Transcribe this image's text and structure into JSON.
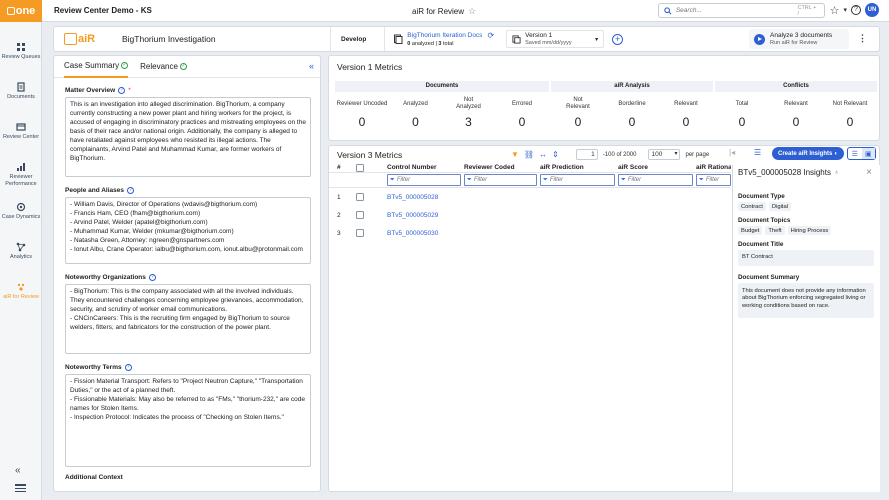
{
  "topbar": {
    "logo_text": "one",
    "app_title": "Review Center Demo - KS",
    "center_title": "aiR for Review",
    "search_placeholder": "Search...",
    "search_shortcut": "CTRL + /",
    "user_initials": "UN"
  },
  "sidebar": {
    "items": [
      {
        "label": "Review Queues",
        "icon": "review-queues-icon"
      },
      {
        "label": "Documents",
        "icon": "documents-icon"
      },
      {
        "label": "Review Center",
        "icon": "review-center-icon"
      },
      {
        "label": "Reviewer Performance",
        "icon": "reviewer-performance-icon"
      },
      {
        "label": "Case Dynamics",
        "icon": "case-dynamics-icon"
      },
      {
        "label": "Analytics",
        "icon": "analytics-icon"
      },
      {
        "label": "aiR for Review",
        "icon": "air-icon"
      }
    ]
  },
  "header": {
    "air_logo_text": "aiR",
    "investigation": "BigThorium Investigation",
    "develop": "Develop",
    "docs_name": "BigThorium Iteration Docs",
    "docs_analyzed": "0",
    "docs_analyzed_label": "analyzed",
    "docs_total": "3",
    "docs_total_label": "total",
    "version_name": "Version 1",
    "version_saved": "Saved mm/dd/yyyy",
    "analyze_title": "Analyze 3 documents",
    "analyze_sub": "Run aiR for Review"
  },
  "left_panel": {
    "tabs": [
      {
        "label": "Case Summary",
        "active": true
      },
      {
        "label": "Relevance",
        "active": false
      }
    ],
    "sections": [
      {
        "label": "Matter Overview",
        "required": "*",
        "text": "This is an investigation into alleged discrimination. BigThorium, a company currently constructing a new power plant and hiring workers for the project, is accused of engaging in discriminatory practices and mistreating employees on the basis of their race and/or national origin. Additionally, the company is alleged to have retaliated against employees who resisted its illegal actions. The complainants, Arvind Patel and Muhammad Kumar, are former workers of BigThorium."
      },
      {
        "label": "People and Aliases",
        "text": "- William Davis, Director of Operations (wdavis@bigthorium.com)\n- Francis Ham, CEO (fham@bigthorium.com)\n- Arvind Patel, Welder (apatel@bigthorium.com)\n- Muhammad Kumar, Welder (mkumar@bigthorium.com)\n- Natasha Green, Attorney: ngreen@gnspartners.com\n- Ionut Albu, Crane Operator: ialbu@bigthorium.com, ionut.albu@protonmail.com"
      },
      {
        "label": "Noteworthy Organizations",
        "text": "- BigThorium: This is the company associated with all the involved individuals. They encountered challenges concerning employee grievances, accommodation, security, and scrutiny of worker email communications.\n- CNCinCareers: This is the recruiting firm engaged by BigThorium to source welders, fitters, and fabricators for the construction of the power plant."
      },
      {
        "label": "Noteworthy Terms",
        "text": "- Fission Material Transport: Refers to \"Project Neutron Capture,\" \"Transportation Duties,\" or the act of a planned theft.\n- Fissionable Materials: May also be referred to as \"FMs,\" \"thorium-232,\" are code names for Stolen Items.\n- Inspection Protocol: Indicates the process of \"Checking on Stolen Items.\""
      },
      {
        "label": "Additional Context",
        "text": ""
      }
    ]
  },
  "v1_metrics": {
    "title": "Version 1 Metrics",
    "groups": [
      {
        "name": "Documents",
        "metrics": [
          {
            "label": "Reviewer Uncoded",
            "value": "0"
          },
          {
            "label": "Analyzed",
            "value": "0"
          },
          {
            "label": "Not Analyzed",
            "value": "3"
          },
          {
            "label": "Errored",
            "value": "0"
          }
        ]
      },
      {
        "name": "aiR Analysis",
        "metrics": [
          {
            "label": "Not Relevant",
            "value": "0"
          },
          {
            "label": "Borderline",
            "value": "0"
          },
          {
            "label": "Relevant",
            "value": "0"
          }
        ]
      },
      {
        "name": "Conflicts",
        "metrics": [
          {
            "label": "Total",
            "value": "0"
          },
          {
            "label": "Relevant",
            "value": "0"
          },
          {
            "label": "Not Relevant",
            "value": "0"
          }
        ]
      }
    ]
  },
  "v3_metrics": {
    "title": "Version 3 Metrics",
    "page": "1",
    "page_range": "-100 of 2000",
    "per_page": "100",
    "per_page_label": "per page",
    "create_label": "Create aiR Insights",
    "columns": [
      "#",
      "Control Number",
      "Reviewer Coded",
      "aiR Prediction",
      "aiR Score",
      "aiR Rationale"
    ],
    "filter_placeholder": "Filter",
    "rows": [
      {
        "num": "1",
        "control": "BTv5_000005028"
      },
      {
        "num": "2",
        "control": "BTv5_000005029"
      },
      {
        "num": "3",
        "control": "BTv5_000005030"
      }
    ]
  },
  "insights": {
    "title": "BTv5_000005028 Insights",
    "doc_type_label": "Document Type",
    "doc_types": [
      "Contract",
      "Digital"
    ],
    "doc_topics_label": "Document Topics",
    "doc_topics": [
      "Budget",
      "Theft",
      "Hiring Process"
    ],
    "doc_title_label": "Document Title",
    "doc_title": "BT Contract",
    "doc_summary_label": "Document Summary",
    "doc_summary": "This document does not provide any information about BigThorium enforcing segregated living or working conditions based on race."
  }
}
